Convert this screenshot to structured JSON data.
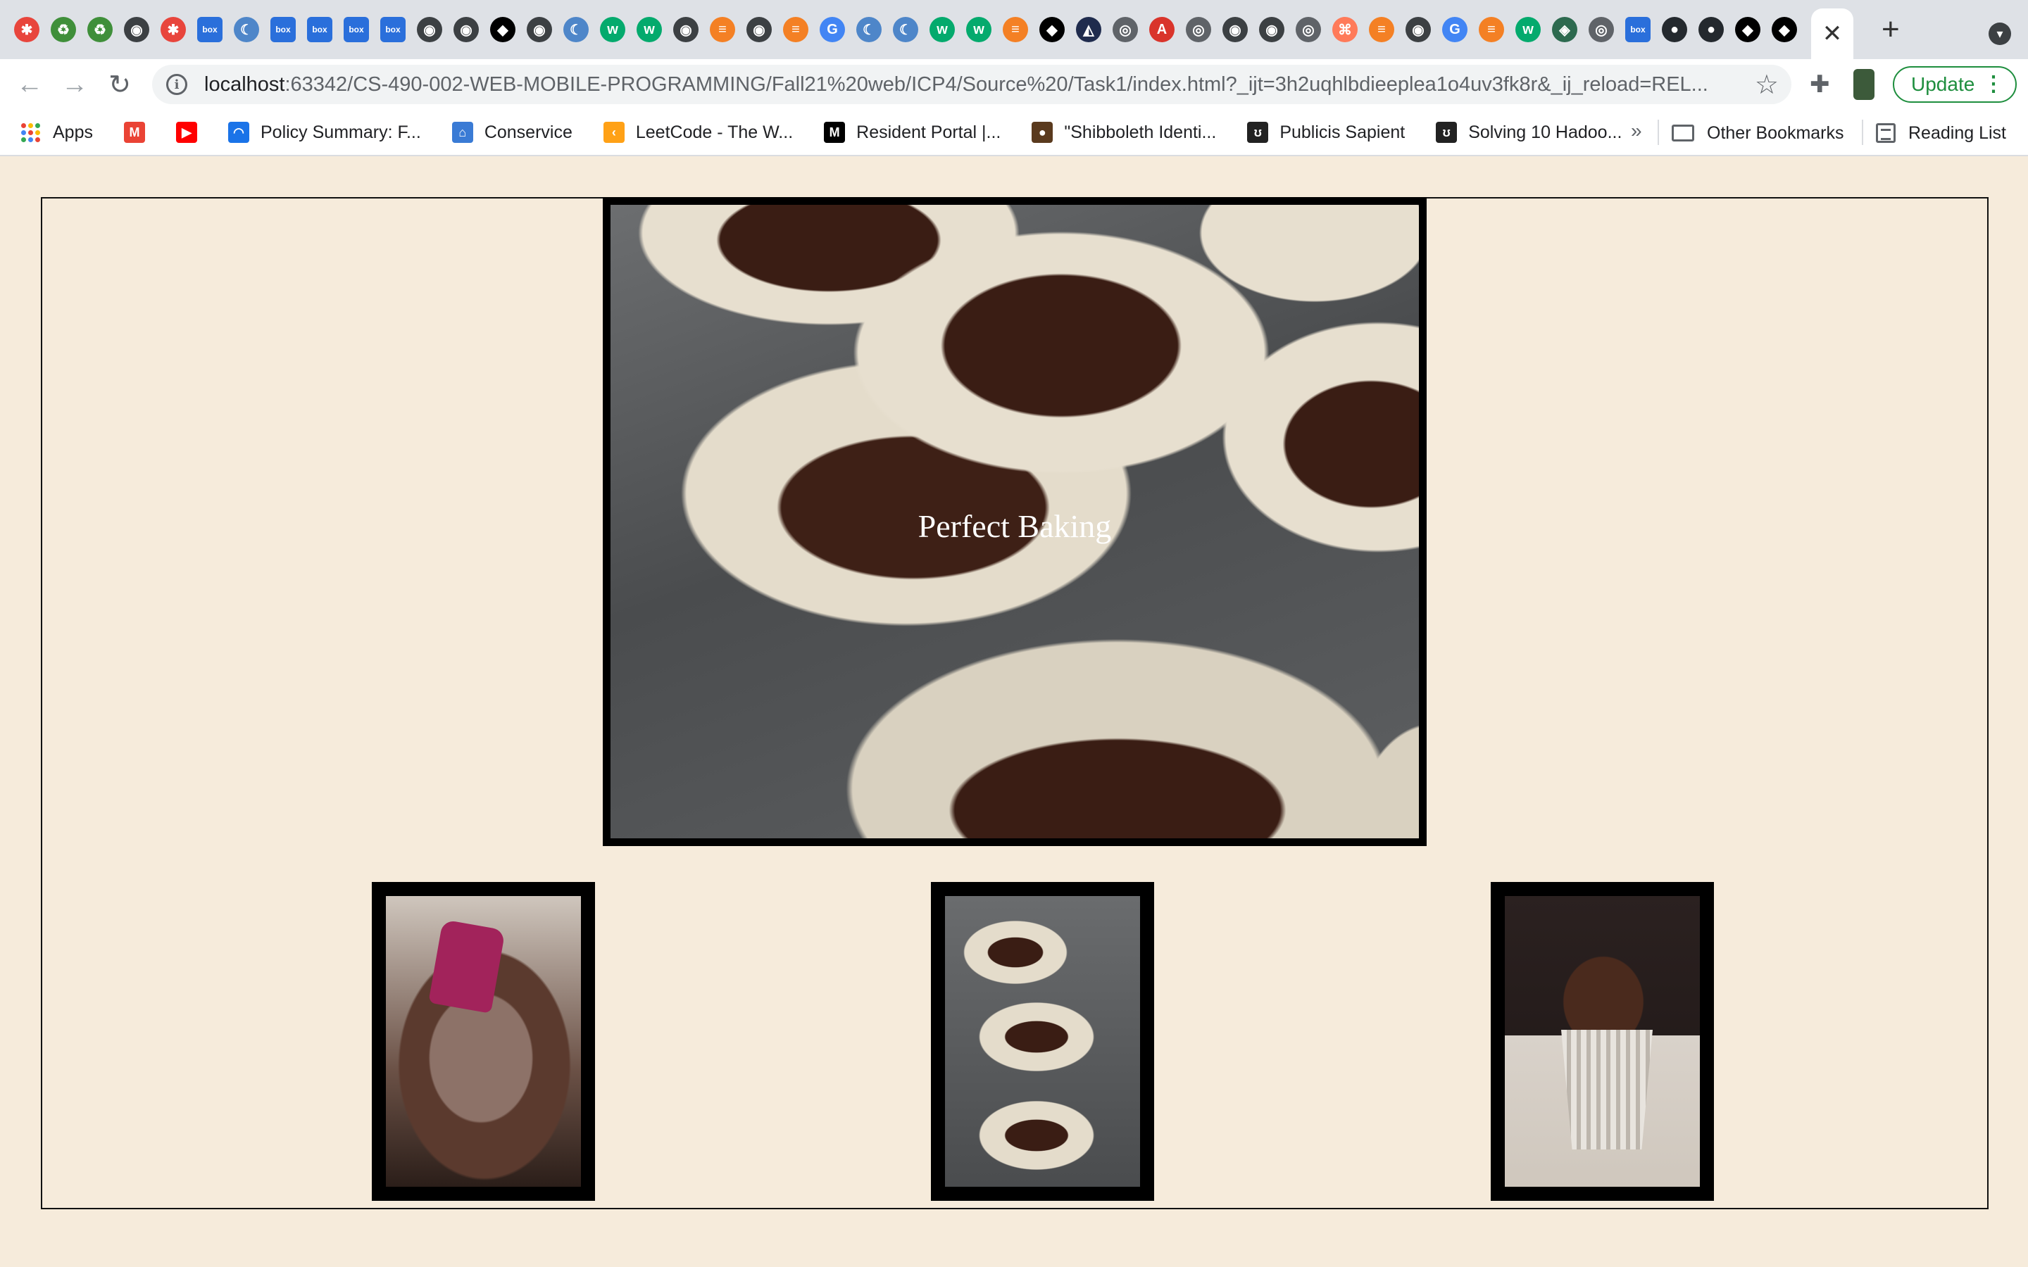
{
  "browser": {
    "tab_icons": [
      {
        "name": "asu-icon",
        "color": "#e8453c",
        "glyph": "✱"
      },
      {
        "name": "recycle-icon",
        "color": "#3f8f3a",
        "glyph": "♻"
      },
      {
        "name": "recycle-icon",
        "color": "#3f8f3a",
        "glyph": "♻"
      },
      {
        "name": "globe-icon",
        "color": "#3c4043",
        "glyph": "◉"
      },
      {
        "name": "asu-icon",
        "color": "#e8453c",
        "glyph": "✱"
      },
      {
        "name": "box-icon",
        "color": "#2a6fdb",
        "glyph": "box"
      },
      {
        "name": "jetbrains-icon",
        "color": "#4e86c9",
        "glyph": "☾"
      },
      {
        "name": "box-icon",
        "color": "#2a6fdb",
        "glyph": "box"
      },
      {
        "name": "box-icon",
        "color": "#2a6fdb",
        "glyph": "box"
      },
      {
        "name": "box-icon",
        "color": "#2a6fdb",
        "glyph": "box"
      },
      {
        "name": "box-icon",
        "color": "#2a6fdb",
        "glyph": "box"
      },
      {
        "name": "globe-icon",
        "color": "#3c4043",
        "glyph": "◉"
      },
      {
        "name": "globe-icon",
        "color": "#3c4043",
        "glyph": "◉"
      },
      {
        "name": "notion-icon",
        "color": "#000000",
        "glyph": "◆"
      },
      {
        "name": "globe-icon",
        "color": "#3c4043",
        "glyph": "◉"
      },
      {
        "name": "jetbrains-icon",
        "color": "#4e86c9",
        "glyph": "☾"
      },
      {
        "name": "w3schools-icon",
        "color": "#04aa6d",
        "glyph": "w"
      },
      {
        "name": "w3schools-icon",
        "color": "#04aa6d",
        "glyph": "w"
      },
      {
        "name": "globe-icon",
        "color": "#3c4043",
        "glyph": "◉"
      },
      {
        "name": "stackoverflow-icon",
        "color": "#f48024",
        "glyph": "≡"
      },
      {
        "name": "globe-icon",
        "color": "#3c4043",
        "glyph": "◉"
      },
      {
        "name": "stackoverflow-icon",
        "color": "#f48024",
        "glyph": "≡"
      },
      {
        "name": "google-icon",
        "color": "#4285f4",
        "glyph": "G"
      },
      {
        "name": "jetbrains-icon",
        "color": "#4e86c9",
        "glyph": "☾"
      },
      {
        "name": "jetbrains-icon",
        "color": "#4e86c9",
        "glyph": "☾"
      },
      {
        "name": "w3schools-icon",
        "color": "#04aa6d",
        "glyph": "w"
      },
      {
        "name": "w3schools-icon",
        "color": "#04aa6d",
        "glyph": "w"
      },
      {
        "name": "stackoverflow-icon",
        "color": "#f48024",
        "glyph": "≡"
      },
      {
        "name": "notion-icon",
        "color": "#000000",
        "glyph": "◆"
      },
      {
        "name": "code-icon",
        "color": "#1f2b4d",
        "glyph": "◭"
      },
      {
        "name": "chrome-icon",
        "color": "#5f6368",
        "glyph": "◎"
      },
      {
        "name": "adobe-icon",
        "color": "#d9342b",
        "glyph": "A"
      },
      {
        "name": "chrome-icon",
        "color": "#5f6368",
        "glyph": "◎"
      },
      {
        "name": "globe-icon",
        "color": "#3c4043",
        "glyph": "◉"
      },
      {
        "name": "globe-icon",
        "color": "#3c4043",
        "glyph": "◉"
      },
      {
        "name": "chrome-icon",
        "color": "#5f6368",
        "glyph": "◎"
      },
      {
        "name": "hubspot-icon",
        "color": "#ff7a59",
        "glyph": "⌘"
      },
      {
        "name": "stackoverflow-icon",
        "color": "#f48024",
        "glyph": "≡"
      },
      {
        "name": "globe-icon",
        "color": "#3c4043",
        "glyph": "◉"
      },
      {
        "name": "google-icon",
        "color": "#4285f4",
        "glyph": "G"
      },
      {
        "name": "stackoverflow-icon",
        "color": "#f48024",
        "glyph": "≡"
      },
      {
        "name": "w3schools-icon",
        "color": "#04aa6d",
        "glyph": "w"
      },
      {
        "name": "diamond-icon",
        "color": "#2d6a4f",
        "glyph": "◈"
      },
      {
        "name": "chrome-icon",
        "color": "#5f6368",
        "glyph": "◎"
      },
      {
        "name": "box-icon",
        "color": "#2a6fdb",
        "glyph": "box"
      },
      {
        "name": "github-icon",
        "color": "#24292e",
        "glyph": "●"
      },
      {
        "name": "github-icon",
        "color": "#24292e",
        "glyph": "●"
      },
      {
        "name": "notion-icon",
        "color": "#000000",
        "glyph": "◆"
      },
      {
        "name": "notion-icon",
        "color": "#000000",
        "glyph": "◆"
      }
    ],
    "active_tab_close": "✕",
    "new_tab": "+",
    "back": "←",
    "forward": "→",
    "reload": "↻",
    "info": "i",
    "url_host": "localhost",
    "url_rest": ":63342/CS-490-002-WEB-MOBILE-PROGRAMMING/Fall21%20web/ICP4/Source%20/Task1/index.html?_ijt=3h2uqhlbdieeplea1o4uv3fk8r&_ij_reload=REL...",
    "star": "☆",
    "extensions": "✚",
    "update_label": "Update",
    "menu_dots": "⋮",
    "tab_menu": "▾"
  },
  "bookmarks": {
    "items": [
      {
        "label": "Apps",
        "icon": "apps-grid-icon",
        "color": ""
      },
      {
        "label": "",
        "icon": "gmail-icon",
        "color": "#ea4335",
        "glyph": "M"
      },
      {
        "label": "",
        "icon": "youtube-icon",
        "color": "#ff0000",
        "glyph": "▶"
      },
      {
        "label": "Policy Summary: F...",
        "icon": "policy-icon",
        "color": "#1a73e8",
        "glyph": "◠"
      },
      {
        "label": "Conservice",
        "icon": "home-icon",
        "color": "#3a7bd5",
        "glyph": "⌂"
      },
      {
        "label": "LeetCode - The W...",
        "icon": "leetcode-icon",
        "color": "#ffa116",
        "glyph": "‹"
      },
      {
        "label": "Resident Portal |...",
        "icon": "resident-portal-icon",
        "color": "#000000",
        "glyph": "M"
      },
      {
        "label": "\"Shibboleth Identi...",
        "icon": "shibboleth-icon",
        "color": "#5a3a1e",
        "glyph": "●"
      },
      {
        "label": "Publicis Sapient",
        "icon": "publicis-icon",
        "color": "#222222",
        "glyph": "ʊ"
      },
      {
        "label": "Solving 10 Hadoo...",
        "icon": "publicis-icon",
        "color": "#222222",
        "glyph": "ʊ"
      }
    ],
    "more": "»",
    "other_bookmarks": "Other Bookmarks",
    "reading_list": "Reading List"
  },
  "page": {
    "hero_title": "Perfect Baking",
    "images": [
      {
        "name": "brownie-batter-image"
      },
      {
        "name": "cupcake-pan-image"
      },
      {
        "name": "frosted-cupcake-image"
      }
    ]
  }
}
